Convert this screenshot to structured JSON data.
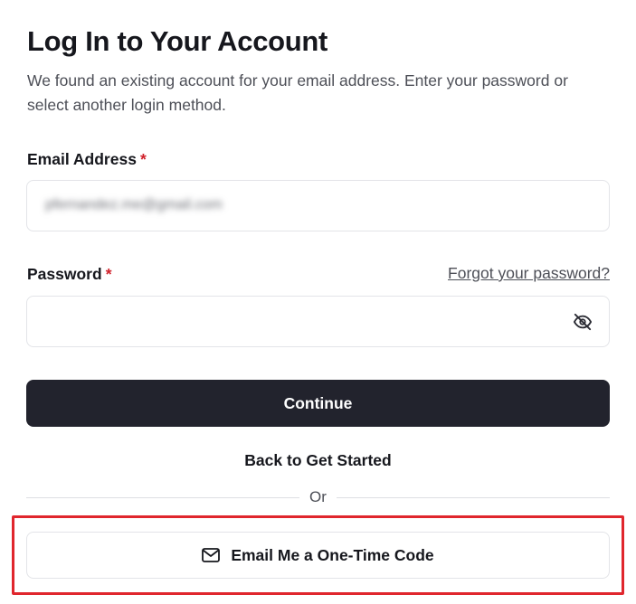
{
  "header": {
    "title": "Log In to Your Account",
    "subtitle": "We found an existing account for your email address. Enter your password or select another login method."
  },
  "email": {
    "label": "Email Address",
    "required_mark": "*",
    "value": "pfernandez.me@gmail.com"
  },
  "password": {
    "label": "Password",
    "required_mark": "*",
    "forgot_link": "Forgot your password?",
    "value": "",
    "toggle_icon": "eye-off-icon"
  },
  "actions": {
    "continue_label": "Continue",
    "back_label": "Back to Get Started",
    "divider_text": "Or",
    "otp_label": "Email Me a One-Time Code",
    "otp_icon": "mail-icon"
  },
  "colors": {
    "primary_button": "#22232d",
    "required": "#d0202a",
    "highlight": "#e0262d"
  }
}
